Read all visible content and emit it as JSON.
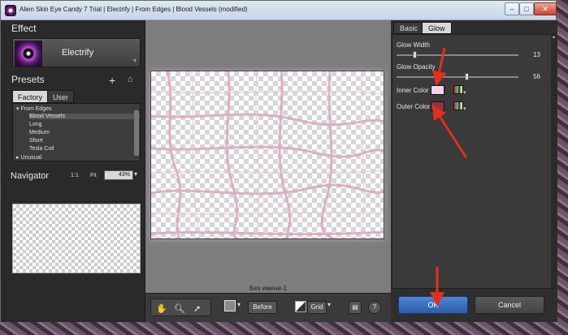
{
  "window": {
    "title": "Alien Skin Eye Candy 7 Trial | Electrify | From Edges | Blood Vessels (modified)",
    "min_glyph": "–",
    "max_glyph": "□",
    "close_glyph": "✕"
  },
  "left": {
    "effect_label": "Effect",
    "effect_name": "Electrify",
    "presets_label": "Presets",
    "add_glyph": "+",
    "home_glyph": "⌂",
    "tabs": [
      "Factory",
      "User"
    ],
    "tree": [
      {
        "label": "▾ From Edges",
        "selected": false
      },
      {
        "label": "Blood Vessels",
        "selected": true
      },
      {
        "label": "Long",
        "selected": false
      },
      {
        "label": "Medium",
        "selected": false
      },
      {
        "label": "Short",
        "selected": false
      },
      {
        "label": "Tesla Coil",
        "selected": false
      },
      {
        "label": "▸ Unusual",
        "selected": false
      }
    ],
    "navigator_label": "Navigator",
    "ratio": "1:1",
    "fit": "Fit",
    "zoom": "43%"
  },
  "center": {
    "document_name": "Без имени-1",
    "before_label": "Before",
    "grid_label": "Grid",
    "help_glyph": "?"
  },
  "right": {
    "tabs": [
      "Basic",
      "Glow"
    ],
    "glow_width_label": "Glow Width",
    "glow_width_value": "13",
    "glow_opacity_label": "Glow Opacity",
    "glow_opacity_value": "56",
    "inner_color_label": "Inner Color",
    "outer_color_label": "Outer Color",
    "ok_label": "OK",
    "cancel_label": "Cancel"
  },
  "sliders": {
    "glow_width_fraction": 0.13,
    "glow_opacity_fraction": 0.56
  },
  "colors": {
    "inner_color": "#f4d3ea",
    "outer_color": "#8c3640",
    "accent_ok": "#3a6fc0",
    "annotation_arrow": "#e0301e"
  },
  "icons": [
    "hand-icon",
    "zoom-icon",
    "pointer-icon",
    "home-icon",
    "color-picker-icon",
    "help-icon"
  ]
}
